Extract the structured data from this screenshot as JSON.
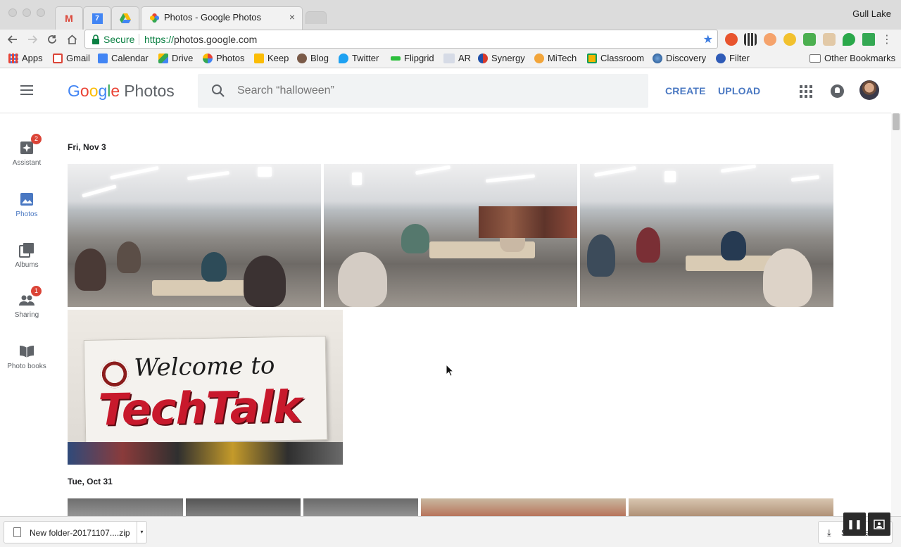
{
  "browser": {
    "active_tab_title": "Photos - Google Photos",
    "tab_close_glyph": "×",
    "profile_name": "Gull Lake",
    "secure_label": "Secure",
    "url_scheme": "https://",
    "url_host": "photos.google.com",
    "bookmarks": [
      "Apps",
      "Gmail",
      "Calendar",
      "Drive",
      "Photos",
      "Keep",
      "Blog",
      "Twitter",
      "Flipgrid",
      "AR",
      "Synergy",
      "MiTech",
      "Classroom",
      "Discovery",
      "Filter"
    ],
    "other_bookmarks": "Other Bookmarks",
    "pinned_tab_calendar_num": "7"
  },
  "header": {
    "logo_google": [
      "G",
      "o",
      "o",
      "g",
      "l",
      "e"
    ],
    "logo_product": "Photos",
    "search_placeholder": "Search “halloween”",
    "create_label": "CREATE",
    "upload_label": "UPLOAD"
  },
  "nav": {
    "items": [
      {
        "label": "Assistant",
        "icon": "assistant-icon",
        "badge": "2"
      },
      {
        "label": "Photos",
        "icon": "photos-icon",
        "badge": ""
      },
      {
        "label": "Albums",
        "icon": "albums-icon",
        "badge": ""
      },
      {
        "label": "Sharing",
        "icon": "sharing-icon",
        "badge": "1"
      },
      {
        "label": "Photo books",
        "icon": "photo-books-icon",
        "badge": ""
      }
    ]
  },
  "content": {
    "groups": [
      {
        "date": "Fri, Nov 3"
      },
      {
        "date": "Tue, Oct 31"
      }
    ],
    "banner": {
      "line1": "Welcome to",
      "line2": "TechTalk"
    }
  },
  "downloads": {
    "file_name": "New folder-20171107....zip",
    "caret": "▾",
    "show_all_label": "Show all"
  },
  "colors": {
    "accent": "#4a78c2",
    "badge": "#db4437"
  }
}
